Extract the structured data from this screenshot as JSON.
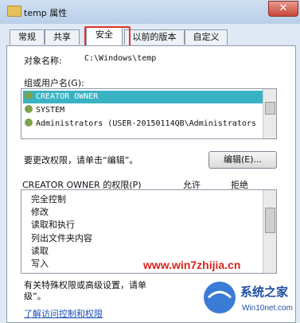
{
  "window": {
    "title": "temp 属性",
    "close_label": "✕"
  },
  "tabs": [
    "常规",
    "共享",
    "安全",
    "以前的版本",
    "自定义"
  ],
  "object": {
    "label": "对象名称:",
    "value": "C:\\Windows\\temp"
  },
  "groups_label": "组或用户名(G):",
  "users": [
    {
      "name": "CREATOR OWNER",
      "selected": true
    },
    {
      "name": "SYSTEM",
      "selected": false
    },
    {
      "name": "Administrators (USER-20150114QB\\Administrators",
      "selected": false
    }
  ],
  "change_note": "要更改权限，请单击“编辑”。",
  "edit_button": "编辑(E)...",
  "permissions": {
    "title": "CREATOR OWNER 的权限(P)",
    "allow": "允许",
    "deny": "拒绝",
    "items": [
      "完全控制",
      "修改",
      "读取和执行",
      "列出文件夹内容",
      "读取",
      "写入"
    ]
  },
  "special_note_line1": "有关特殊权限或高级设置，请单",
  "special_note_line2": "级”。",
  "learn_link": "了解访问控制和权限",
  "watermark": "www.win7zhijia.cn",
  "logo_text": "系统之家",
  "logo_url": "Win10net.com"
}
